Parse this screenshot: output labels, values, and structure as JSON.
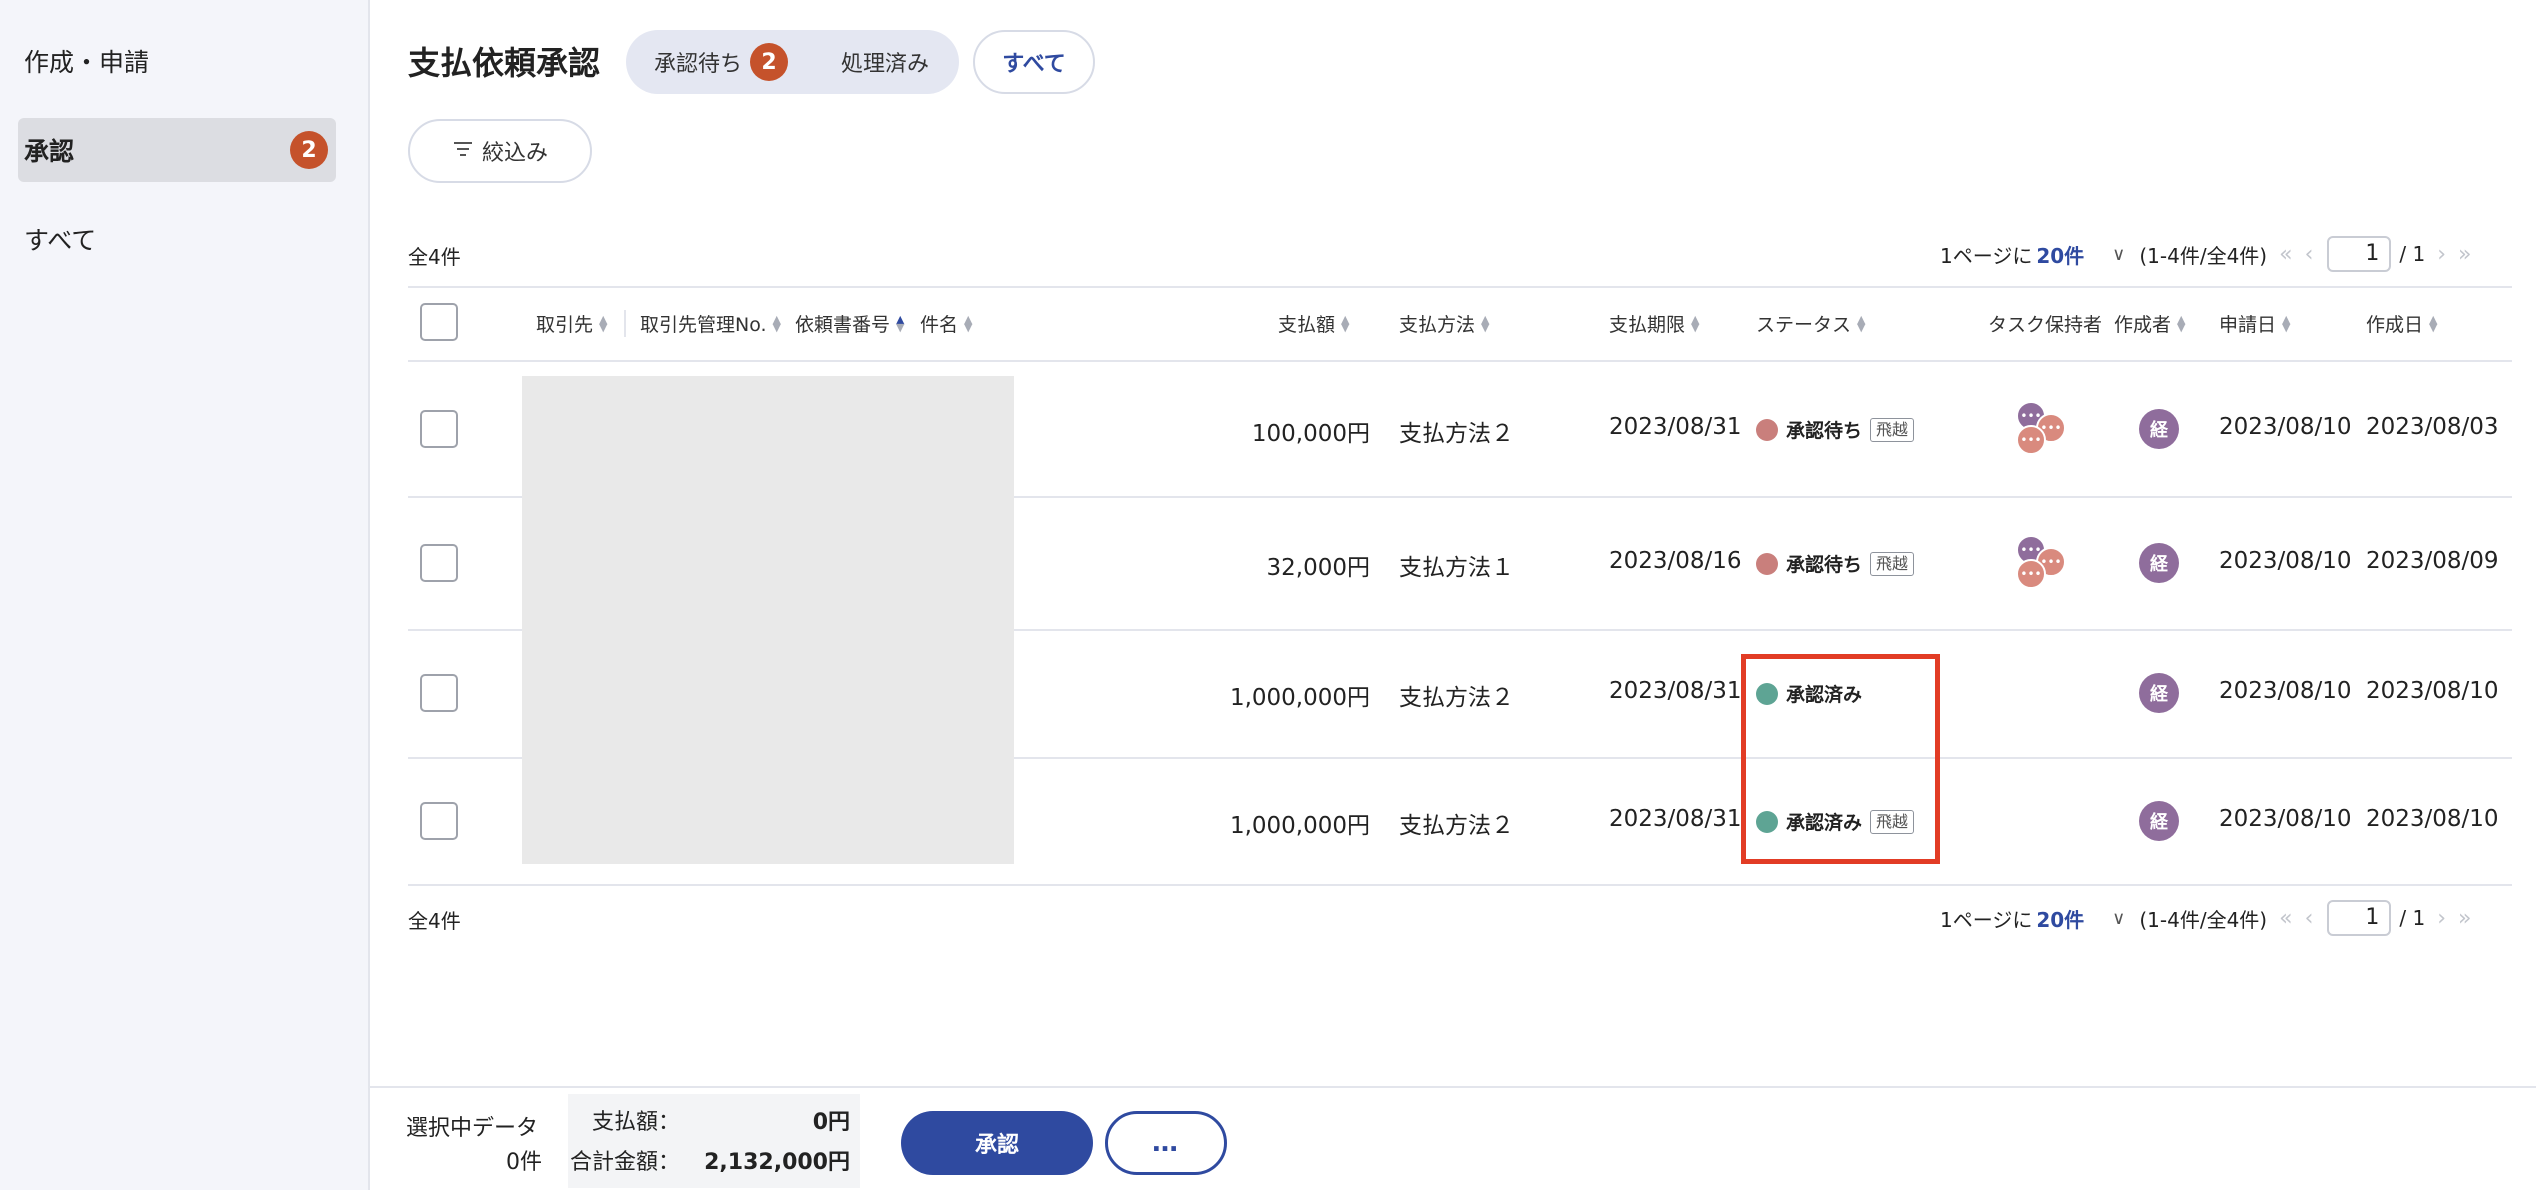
{
  "sidebar": {
    "items": [
      {
        "label": "作成・申請"
      },
      {
        "label": "承認",
        "badge": "2"
      },
      {
        "label": "すべて"
      }
    ]
  },
  "header": {
    "title": "支払依頼承認",
    "tabs": {
      "pending": "承認待ち",
      "pending_badge": "2",
      "processed": "処理済み",
      "all": "すべて"
    },
    "filter_label": "絞込み"
  },
  "pagination": {
    "total": "全4件",
    "per_page_prefix": "1ページに",
    "per_page_value": "20件",
    "range": "(1-4件/全4件)",
    "current_page": "1",
    "total_pages": "/ 1"
  },
  "table": {
    "columns": {
      "vendor": "取引先",
      "vendor_no": "取引先管理No.",
      "request_no": "依頼書番号",
      "subject": "件名",
      "amount": "支払額",
      "method": "支払方法",
      "due": "支払期限",
      "status": "ステータス",
      "task_holder": "タスク保持者",
      "creator": "作成者",
      "applied": "申請日",
      "created": "作成日"
    },
    "rows": [
      {
        "amount": "100,000円",
        "method": "支払方法２",
        "due": "2023/08/31",
        "status": "承認待ち",
        "skip": "飛越",
        "creator": "経",
        "applied": "2023/08/10",
        "created": "2023/08/03"
      },
      {
        "amount": "32,000円",
        "method": "支払方法１",
        "due": "2023/08/16",
        "status": "承認待ち",
        "skip": "飛越",
        "creator": "経",
        "applied": "2023/08/10",
        "created": "2023/08/09"
      },
      {
        "amount": "1,000,000円",
        "method": "支払方法２",
        "due": "2023/08/31",
        "status": "承認済み",
        "creator": "経",
        "applied": "2023/08/10",
        "created": "2023/08/10"
      },
      {
        "amount": "1,000,000円",
        "method": "支払方法２",
        "due": "2023/08/31",
        "status": "承認済み",
        "skip": "飛越",
        "creator": "経",
        "applied": "2023/08/10",
        "created": "2023/08/10"
      }
    ]
  },
  "colors": {
    "pending": "#c97f7c",
    "approved": "#5ea494",
    "accent": "#2f4aa0",
    "badge": "#c5522b",
    "highlight": "#e23c25"
  },
  "footer": {
    "selected_label": "選択中データ",
    "selected_count": "0件",
    "amount_label": "支払額：",
    "amount_value": "0円",
    "total_label": "合計金額：",
    "total_value": "2,132,000円",
    "approve_label": "承認",
    "more_label": "…"
  }
}
